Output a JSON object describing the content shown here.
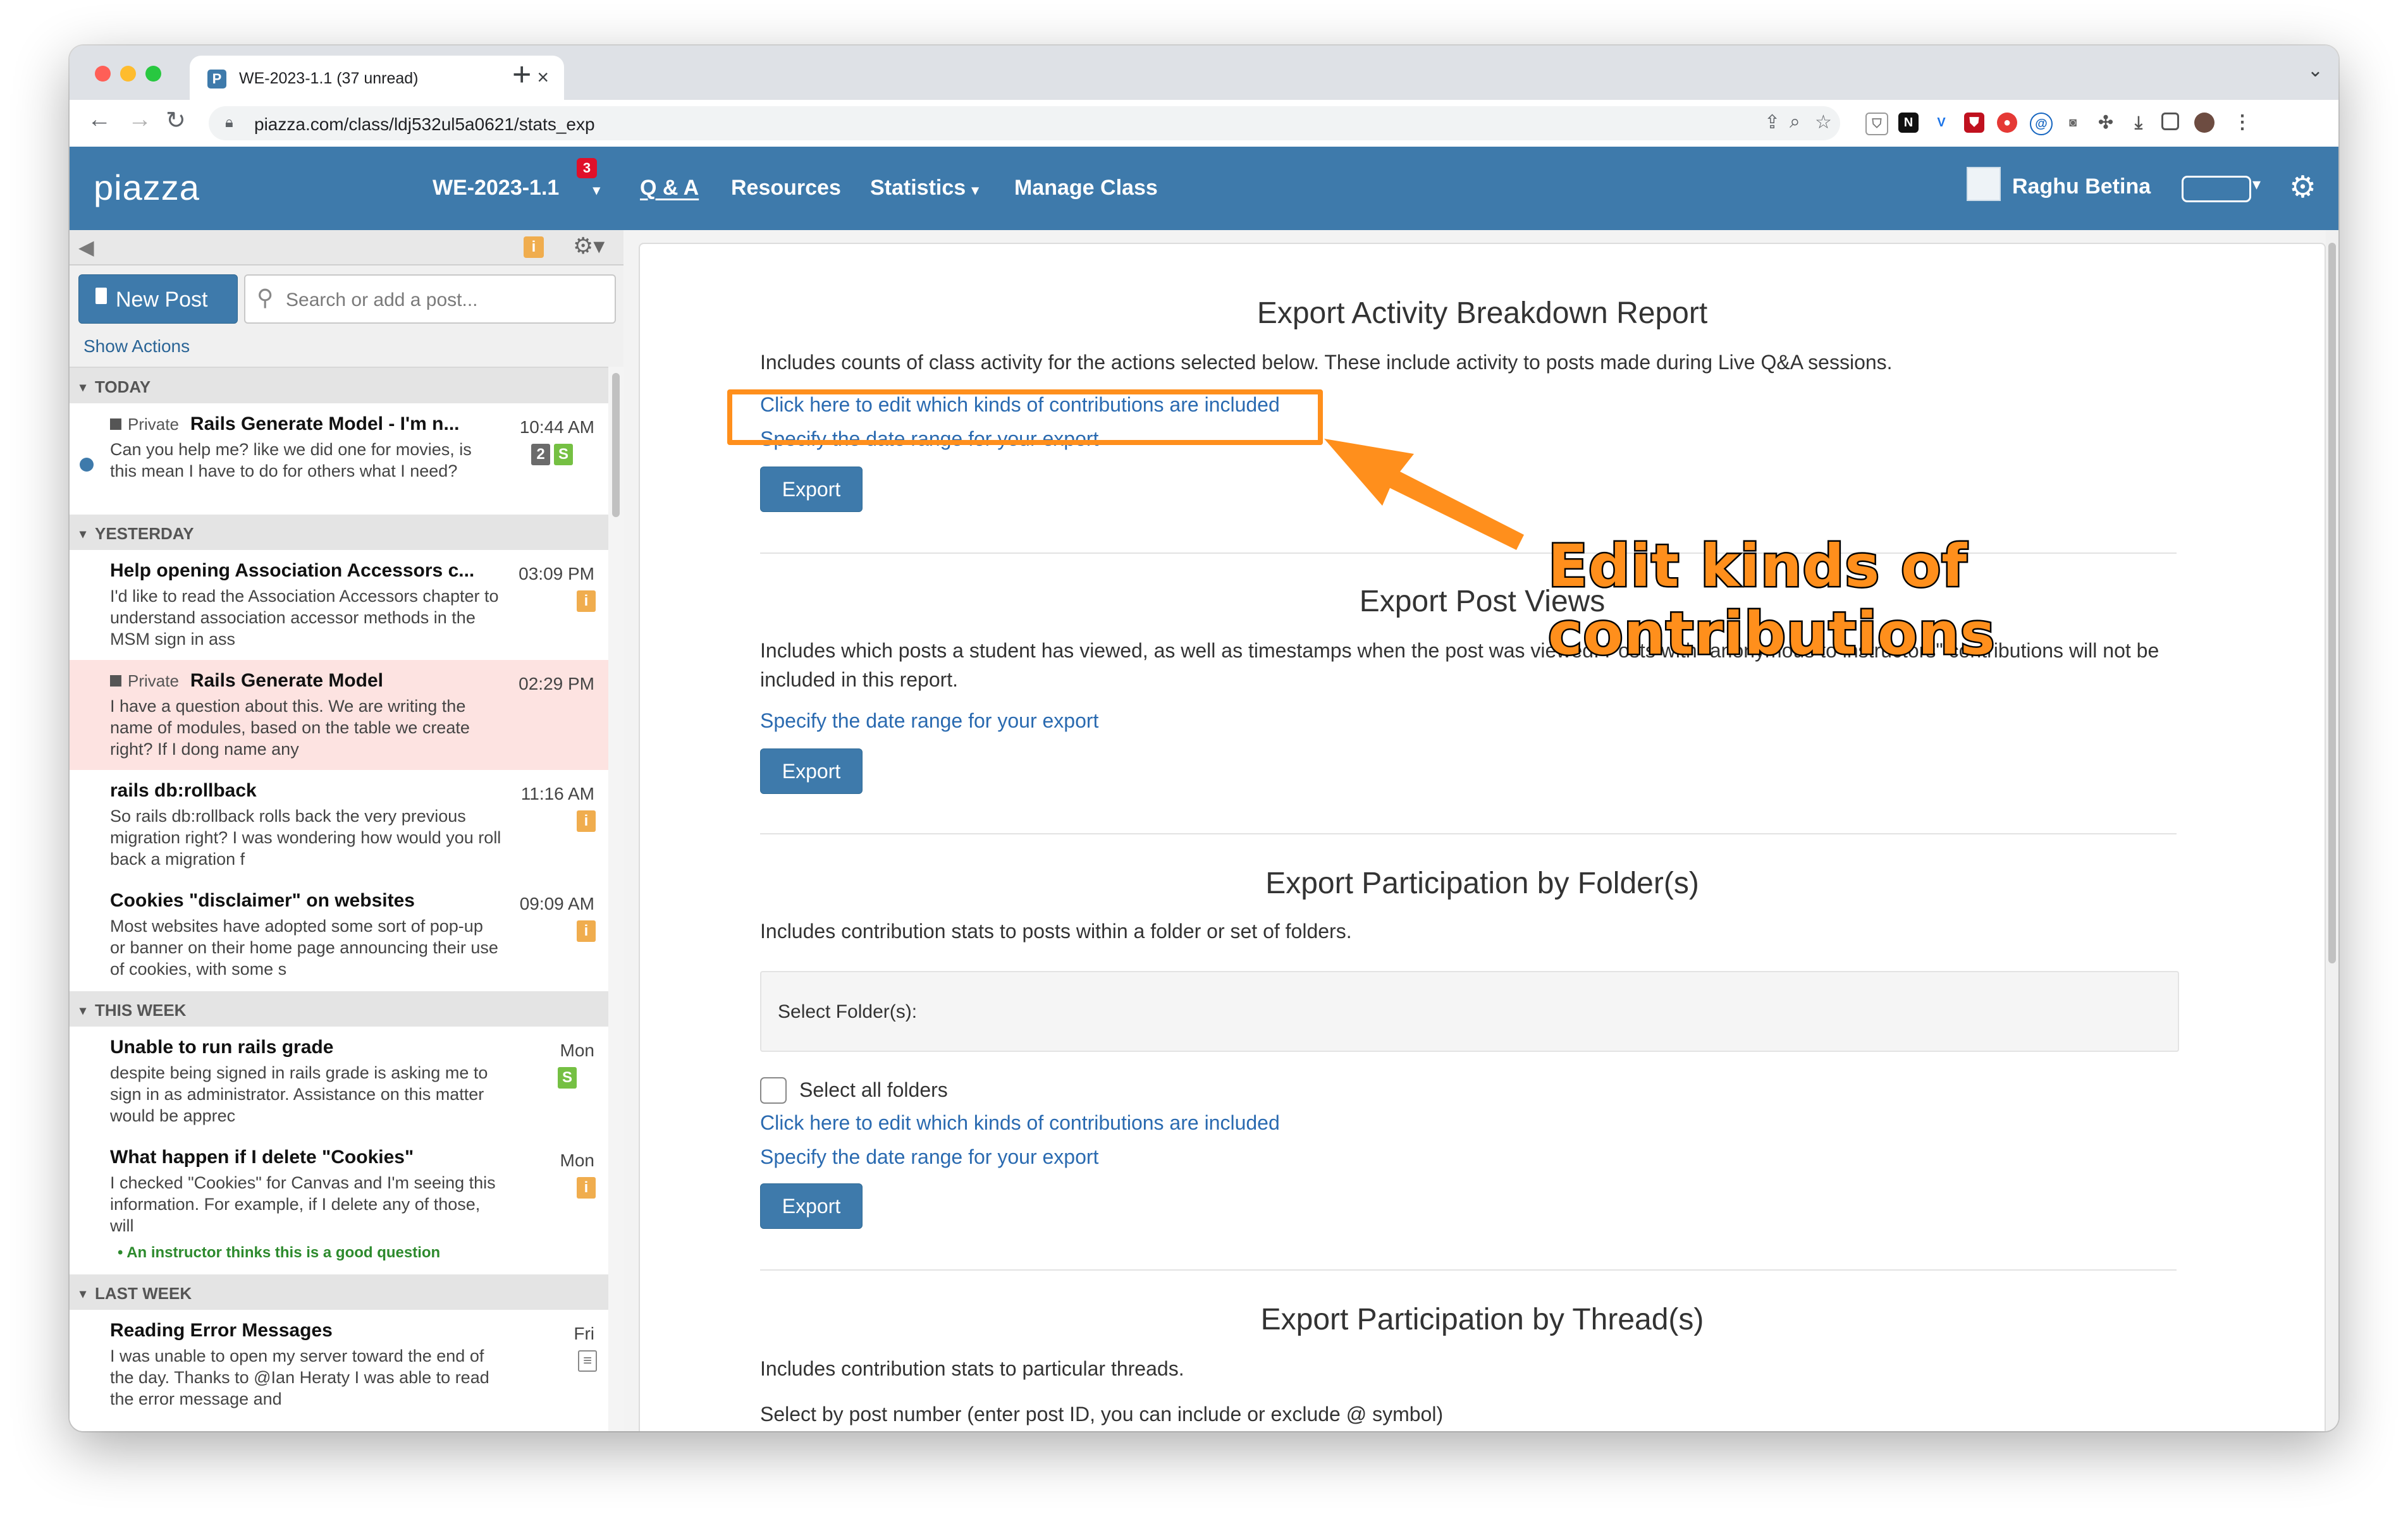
{
  "browser": {
    "tab_title": "WE-2023-1.1 (37 unread)",
    "tab_close": "×",
    "new_tab": "+",
    "url": "piazza.com/class/ldj532ul5a0621/stats_exp"
  },
  "header": {
    "logo": "piazza",
    "class_name": "WE-2023-1.1",
    "class_badge": "3",
    "nav": [
      "Q & A",
      "Resources",
      "Statistics",
      "Manage Class"
    ],
    "user_name": "Raghu Betina"
  },
  "sidebar": {
    "new_post_label": "New Post",
    "search_placeholder": "Search or add a post...",
    "info_badge": "i",
    "show_actions": "Show Actions",
    "groups": {
      "today": "TODAY",
      "yesterday": "YESTERDAY",
      "this_week": "THIS WEEK",
      "last_week": "LAST WEEK"
    },
    "posts": [
      {
        "private": "Private",
        "title": "Rails Generate Model - I'm n...",
        "time": "10:44 AM",
        "snippet": "Can you help me? like we did one for movies, is this mean I have to do for others what I need?",
        "badges": [
          "2",
          "S"
        ]
      },
      {
        "title": "Help opening Association Accessors c...",
        "time": "03:09 PM",
        "snippet": "I'd like to read the Association Accessors chapter to understand association accessor methods in the MSM sign in ass",
        "badges": [
          "i"
        ]
      },
      {
        "private": "Private",
        "title": "Rails Generate Model",
        "time": "02:29 PM",
        "snippet": "I have a question about this. We are writing the name of modules, based on the table we create right? If I dong name any"
      },
      {
        "title": "rails db:rollback",
        "time": "11:16 AM",
        "snippet": "So rails db:rollback rolls back the very previous migration right? I was wondering how would you roll back a migration f",
        "badges": [
          "i"
        ]
      },
      {
        "title": "Cookies \"disclaimer\" on websites",
        "time": "09:09 AM",
        "snippet": "Most websites have adopted some sort of pop-up or banner on their home page announcing their use of cookies, with some s",
        "badges": [
          "i"
        ]
      },
      {
        "title": "Unable to run rails grade",
        "time": "Mon",
        "snippet": "despite being signed in rails grade is asking me to sign in as administrator.  Assistance on this matter would be apprec",
        "badges": [
          "S"
        ]
      },
      {
        "title": "What happen if I delete \"Cookies\"",
        "time": "Mon",
        "snippet": "I checked \"Cookies\" for Canvas and I'm seeing this information. For example,  if I delete any of those, will",
        "badges": [
          "i"
        ],
        "endorsement": "An instructor thinks this is a good question"
      },
      {
        "title": "Reading Error Messages",
        "time": "Fri",
        "snippet": "I was unable to open my server toward the end of the day. Thanks to @Ian Heraty I was able to read the error message and"
      }
    ]
  },
  "main": {
    "breakdown": {
      "title": "Export Activity Breakdown Report",
      "description": "Includes counts of class activity for the actions selected below. These include activity to posts made during Live Q&A sessions.",
      "edit_link": "Click here to edit which kinds of contributions are included",
      "date_link": "Specify the date range for your export",
      "export_label": "Export"
    },
    "post_views": {
      "title": "Export Post Views",
      "description": "Includes which posts a student has viewed, as well as timestamps when the post was viewed. Posts with \"anonymous to instructors\" contributions will not be included in this report.",
      "date_link": "Specify the date range for your export",
      "export_label": "Export"
    },
    "folders": {
      "title": "Export Participation by Folder(s)",
      "description": "Includes contribution stats to posts within a folder or set of folders.",
      "select_label": "Select Folder(s):",
      "select_all_label": "Select all folders",
      "edit_link": "Click here to edit which kinds of contributions are included",
      "date_link": "Specify the date range for your export",
      "export_label": "Export"
    },
    "threads": {
      "title": "Export Participation by Thread(s)",
      "description": "Includes contribution stats to particular threads.",
      "post_number_label": "Select by post number (enter post ID, you can include or exclude @ symbol)"
    }
  },
  "annotation": {
    "callout": "Edit kinds of contributions",
    "color": "#ff8f1c"
  }
}
